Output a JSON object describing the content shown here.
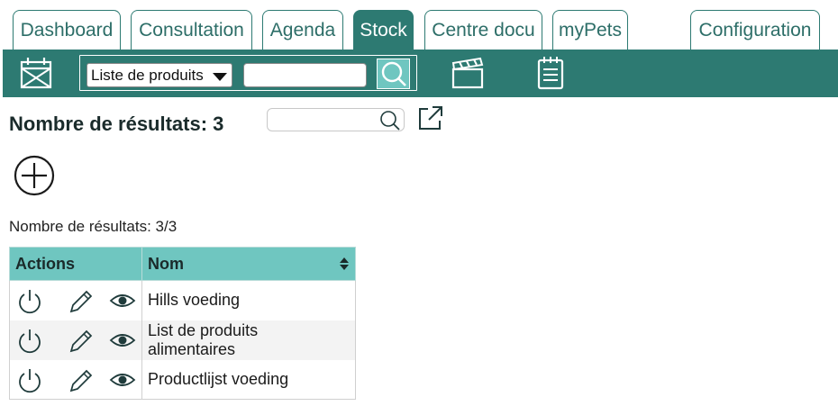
{
  "tabs": [
    {
      "label": "Dashboard",
      "active": false
    },
    {
      "label": "Consultation",
      "active": false
    },
    {
      "label": "Agenda",
      "active": false
    },
    {
      "label": "Stock",
      "active": true
    },
    {
      "label": "Centre docu",
      "active": false
    },
    {
      "label": "myPets",
      "active": false
    },
    {
      "label": "Configuration",
      "active": false
    }
  ],
  "toolbar": {
    "select_value": "Liste de produits",
    "search_value": "",
    "icons": [
      "calendar-icon",
      "search-icon",
      "clapperboard-icon",
      "notepad-icon"
    ]
  },
  "content": {
    "results_title": "Nombre de résultats: 3",
    "search_value": "",
    "results_count": "Nombre de résultats: 3/3"
  },
  "table": {
    "headers": {
      "actions": "Actions",
      "name": "Nom"
    },
    "rows": [
      {
        "name": "Hills voeding"
      },
      {
        "name": "List de produits alimentaires"
      },
      {
        "name": "Productlijst voeding"
      }
    ]
  },
  "colors": {
    "primary": "#2d7a72",
    "accent": "#6fc6c0",
    "icon": "#1f3b3b"
  }
}
